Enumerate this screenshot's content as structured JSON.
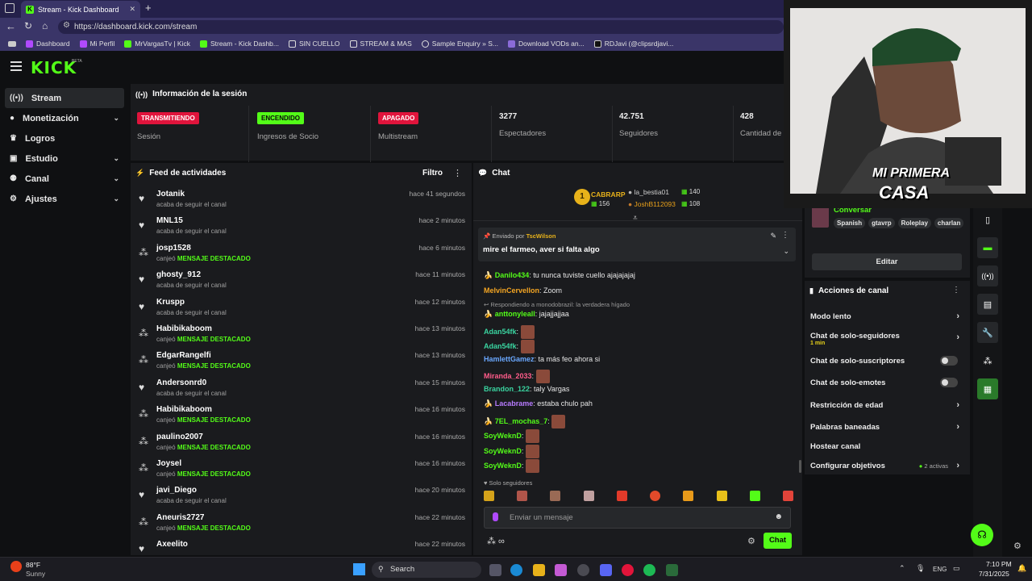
{
  "browser": {
    "tab_title": "Stream - Kick Dashboard",
    "new_tab": "+",
    "url": "https://dashboard.kick.com/stream",
    "bookmarks": [
      "Dashboard",
      "Mi Perfil",
      "MrVargasTv | Kick",
      "Stream - Kick Dashb...",
      "SIN CUELLO",
      "STREAM & MAS",
      "Sample Enquiry » S...",
      "Download VODs an...",
      "RDJavi (@clipsrdjavi..."
    ]
  },
  "app": {
    "logo": "KICK",
    "logo_beta": "BETA",
    "menu_icon": "hamburger-icon"
  },
  "sidebar": {
    "items": [
      {
        "label": "Stream",
        "icon": "broadcast-icon",
        "active": true
      },
      {
        "label": "Monetización",
        "icon": "coin-icon",
        "chevron": true
      },
      {
        "label": "Logros",
        "icon": "trophy-icon"
      },
      {
        "label": "Estudio",
        "icon": "studio-icon",
        "chevron": true
      },
      {
        "label": "Canal",
        "icon": "users-icon",
        "chevron": true
      },
      {
        "label": "Ajustes",
        "icon": "gear-icon",
        "chevron": true
      }
    ]
  },
  "session": {
    "title": "Información de la sesión",
    "stats": [
      {
        "badge": "TRANSMITIENDO",
        "badge_color": "#e0143c",
        "label": "Sesión"
      },
      {
        "badge": "ENCENDIDO",
        "badge_color": "#53fc18",
        "label": "Ingresos de Socio"
      },
      {
        "badge": "APAGADO",
        "badge_color": "#e0143c",
        "label": "Multistream"
      },
      {
        "value": "3277",
        "label": "Espectadores"
      },
      {
        "value": "42.751",
        "label": "Seguidores"
      },
      {
        "value": "428",
        "label": "Cantidad de"
      }
    ]
  },
  "feed": {
    "title": "Feed de actividades",
    "filter": "Filtro",
    "items": [
      {
        "name": "Jotanik",
        "action": "acaba de seguir el canal",
        "highlight": "",
        "time": "hace 41 segundos",
        "type": "follow"
      },
      {
        "name": "MNL15",
        "action": "acaba de seguir el canal",
        "highlight": "",
        "time": "hace 2 minutos",
        "type": "follow"
      },
      {
        "name": "josp1528",
        "action": "canjeó",
        "highlight": "MENSAJE DESTACADO",
        "time": "hace 6 minutos",
        "type": "redeem"
      },
      {
        "name": "ghosty_912",
        "action": "acaba de seguir el canal",
        "highlight": "",
        "time": "hace 11 minutos",
        "type": "follow"
      },
      {
        "name": "Kruspp",
        "action": "acaba de seguir el canal",
        "highlight": "",
        "time": "hace 12 minutos",
        "type": "follow"
      },
      {
        "name": "Habibikaboom",
        "action": "canjeó",
        "highlight": "MENSAJE DESTACADO",
        "time": "hace 13 minutos",
        "type": "redeem"
      },
      {
        "name": "EdgarRangelfi",
        "action": "canjeó",
        "highlight": "MENSAJE DESTACADO",
        "time": "hace 13 minutos",
        "type": "redeem"
      },
      {
        "name": "Andersonrd0",
        "action": "acaba de seguir el canal",
        "highlight": "",
        "time": "hace 15 minutos",
        "type": "follow"
      },
      {
        "name": "Habibikaboom",
        "action": "canjeó",
        "highlight": "MENSAJE DESTACADO",
        "time": "hace 16 minutos",
        "type": "redeem"
      },
      {
        "name": "paulino2007",
        "action": "canjeó",
        "highlight": "MENSAJE DESTACADO",
        "time": "hace 16 minutos",
        "type": "redeem"
      },
      {
        "name": "Joysel",
        "action": "canjeó",
        "highlight": "MENSAJE DESTACADO",
        "time": "hace 16 minutos",
        "type": "redeem"
      },
      {
        "name": "javi_Diego",
        "action": "acaba de seguir el canal",
        "highlight": "",
        "time": "hace 20 minutos",
        "type": "follow"
      },
      {
        "name": "Aneuris2727",
        "action": "canjeó",
        "highlight": "MENSAJE DESTACADO",
        "time": "hace 22 minutos",
        "type": "redeem"
      },
      {
        "name": "Axeelito",
        "action": "",
        "highlight": "",
        "time": "hace 22 minutos",
        "type": "follow"
      }
    ]
  },
  "chat": {
    "title": "Chat",
    "leaderboard": {
      "first": {
        "rank": "1",
        "name": "CABRARP",
        "count": "156"
      },
      "others": [
        {
          "name": "la_bestia01",
          "count": "140"
        },
        {
          "name": "JoshB112093",
          "count": "108"
        }
      ]
    },
    "pinned": {
      "label": "Enviado por",
      "user": "TscWilson",
      "message": "mire el farmeo, aver si falta algo"
    },
    "messages": [
      {
        "user": "Danilo434",
        "color": "#53fc18",
        "text": "tu nunca tuviste cuello ajajajajaj",
        "emotes": 0,
        "reply": ""
      },
      {
        "user": "MelvinCervellon",
        "color": "#f5a623",
        "text": "Zoom",
        "emotes": 0,
        "reply": ""
      },
      {
        "user": "anttonyleall",
        "color": "#53fc18",
        "text": "jajajjajjaa",
        "emotes": 0,
        "reply": "Respondiendo a monodobrazil: la verdadera hígado"
      },
      {
        "user": "Adan54fk",
        "color": "#3ad4a0",
        "text": "",
        "emotes": 1,
        "reply": ""
      },
      {
        "user": "Adan54fk",
        "color": "#3ad4a0",
        "text": "",
        "emotes": 1,
        "reply": ""
      },
      {
        "user": "HamlettGamez",
        "color": "#6aa8ff",
        "text": "ta más feo ahora si",
        "emotes": 0,
        "reply": ""
      },
      {
        "user": "Miranda_2033",
        "color": "#ff5c8a",
        "text": "",
        "emotes": 1,
        "reply": ""
      },
      {
        "user": "Brandon_122",
        "color": "#3ad4a0",
        "text": "taly Vargas",
        "emotes": 0,
        "reply": ""
      },
      {
        "user": "Lacabrame",
        "color": "#b77bff",
        "text": "estaba chulo pah",
        "emotes": 0,
        "reply": ""
      },
      {
        "user": "7EL_mochas_7",
        "color": "#53fc18",
        "text": "",
        "emotes": 1,
        "reply": ""
      },
      {
        "user": "SoyWeknD",
        "color": "#53fc18",
        "text": "",
        "emotes": 1,
        "reply": ""
      },
      {
        "user": "SoyWeknD",
        "color": "#53fc18",
        "text": "",
        "emotes": 1,
        "reply": ""
      },
      {
        "user": "SoyWeknD",
        "color": "#53fc18",
        "text": "",
        "emotes": 1,
        "reply": ""
      }
    ],
    "followers_only": "Solo seguidores",
    "input_placeholder": "Enviar un mensaje",
    "send_button": "Chat"
  },
  "right_panel": {
    "stream_title": "Conversar",
    "tags": [
      "Spanish",
      "gtavrp",
      "Roleplay",
      "charlan"
    ],
    "edit_button": "Editar",
    "actions_title": "Acciones de canal",
    "actions": [
      {
        "label": "Modo lento",
        "sub": "",
        "control": "arrow"
      },
      {
        "label": "Chat de solo-seguidores",
        "sub": "1 min",
        "control": "arrow"
      },
      {
        "label": "Chat de solo-suscriptores",
        "sub": "",
        "control": "toggle"
      },
      {
        "label": "Chat de solo-emotes",
        "sub": "",
        "control": "toggle"
      },
      {
        "label": "Restricción de edad",
        "sub": "",
        "control": "arrow"
      },
      {
        "label": "Palabras baneadas",
        "sub": "",
        "control": "arrow"
      },
      {
        "label": "Hostear canal",
        "sub": "",
        "control": "none"
      },
      {
        "label": "Configurar objetivos",
        "sub": "2 activas",
        "control": "arrow"
      }
    ]
  },
  "webcam": {
    "overlay_text_1": "MI PRIMERA",
    "overlay_text_2": "CASA"
  },
  "taskbar": {
    "weather_temp": "88°F",
    "weather_desc": "Sunny",
    "search": "Search",
    "lang": "ENG",
    "time": "7:10 PM",
    "date": "7/31/2025"
  },
  "colors": {
    "kick_green": "#53fc18",
    "live_red": "#e0143c",
    "bg": "#0f1012",
    "panel": "#1a1b1e"
  }
}
